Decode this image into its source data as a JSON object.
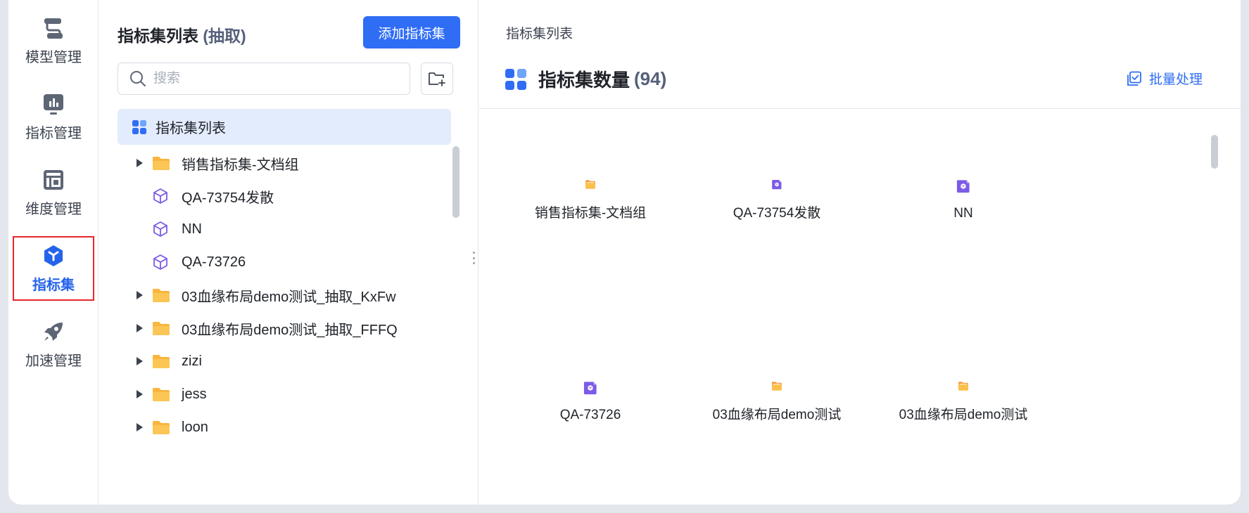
{
  "nav": {
    "items": [
      {
        "label": "模型管理",
        "icon": "model-icon"
      },
      {
        "label": "指标管理",
        "icon": "metric-chart-icon"
      },
      {
        "label": "维度管理",
        "icon": "dimension-icon"
      },
      {
        "label": "指标集",
        "icon": "metric-set-cube-icon",
        "active": true
      },
      {
        "label": "加速管理",
        "icon": "rocket-icon"
      }
    ]
  },
  "tree": {
    "title": "指标集列表",
    "title_suffix": "(抽取)",
    "add_button": "添加指标集",
    "search_placeholder": "搜索",
    "root_label": "指标集列表",
    "items": [
      {
        "label": "销售指标集-文档组",
        "type": "folder",
        "expandable": true
      },
      {
        "label": "QA-73754发散",
        "type": "metric-set",
        "expandable": false
      },
      {
        "label": "NN",
        "type": "metric-set",
        "expandable": false
      },
      {
        "label": "QA-73726",
        "type": "metric-set",
        "expandable": false
      },
      {
        "label": "03血缘布局demo测试_抽取_KxFw",
        "type": "folder",
        "expandable": true
      },
      {
        "label": "03血缘布局demo测试_抽取_FFFQ",
        "type": "folder",
        "expandable": true
      },
      {
        "label": "zizi",
        "type": "folder",
        "expandable": true
      },
      {
        "label": "jess",
        "type": "folder",
        "expandable": true
      },
      {
        "label": "loon",
        "type": "folder",
        "expandable": true
      }
    ]
  },
  "content": {
    "breadcrumb": "指标集列表",
    "title": "指标集数量",
    "count": "(94)",
    "batch_button": "批量处理",
    "cards": [
      {
        "label": "销售指标集-文档组",
        "type": "folder"
      },
      {
        "label": "QA-73754发散",
        "type": "metric-set"
      },
      {
        "label": "NN",
        "type": "metric-set"
      },
      {
        "label": "QA-73726",
        "type": "metric-set"
      },
      {
        "label": "03血缘布局demo测试",
        "type": "folder"
      },
      {
        "label": "03血缘布局demo测试",
        "type": "folder"
      }
    ]
  },
  "colors": {
    "accent": "#2f6df5",
    "active_outline": "#e8262a",
    "folder": "#f7a92b",
    "metric_set": "#7b5be8"
  }
}
